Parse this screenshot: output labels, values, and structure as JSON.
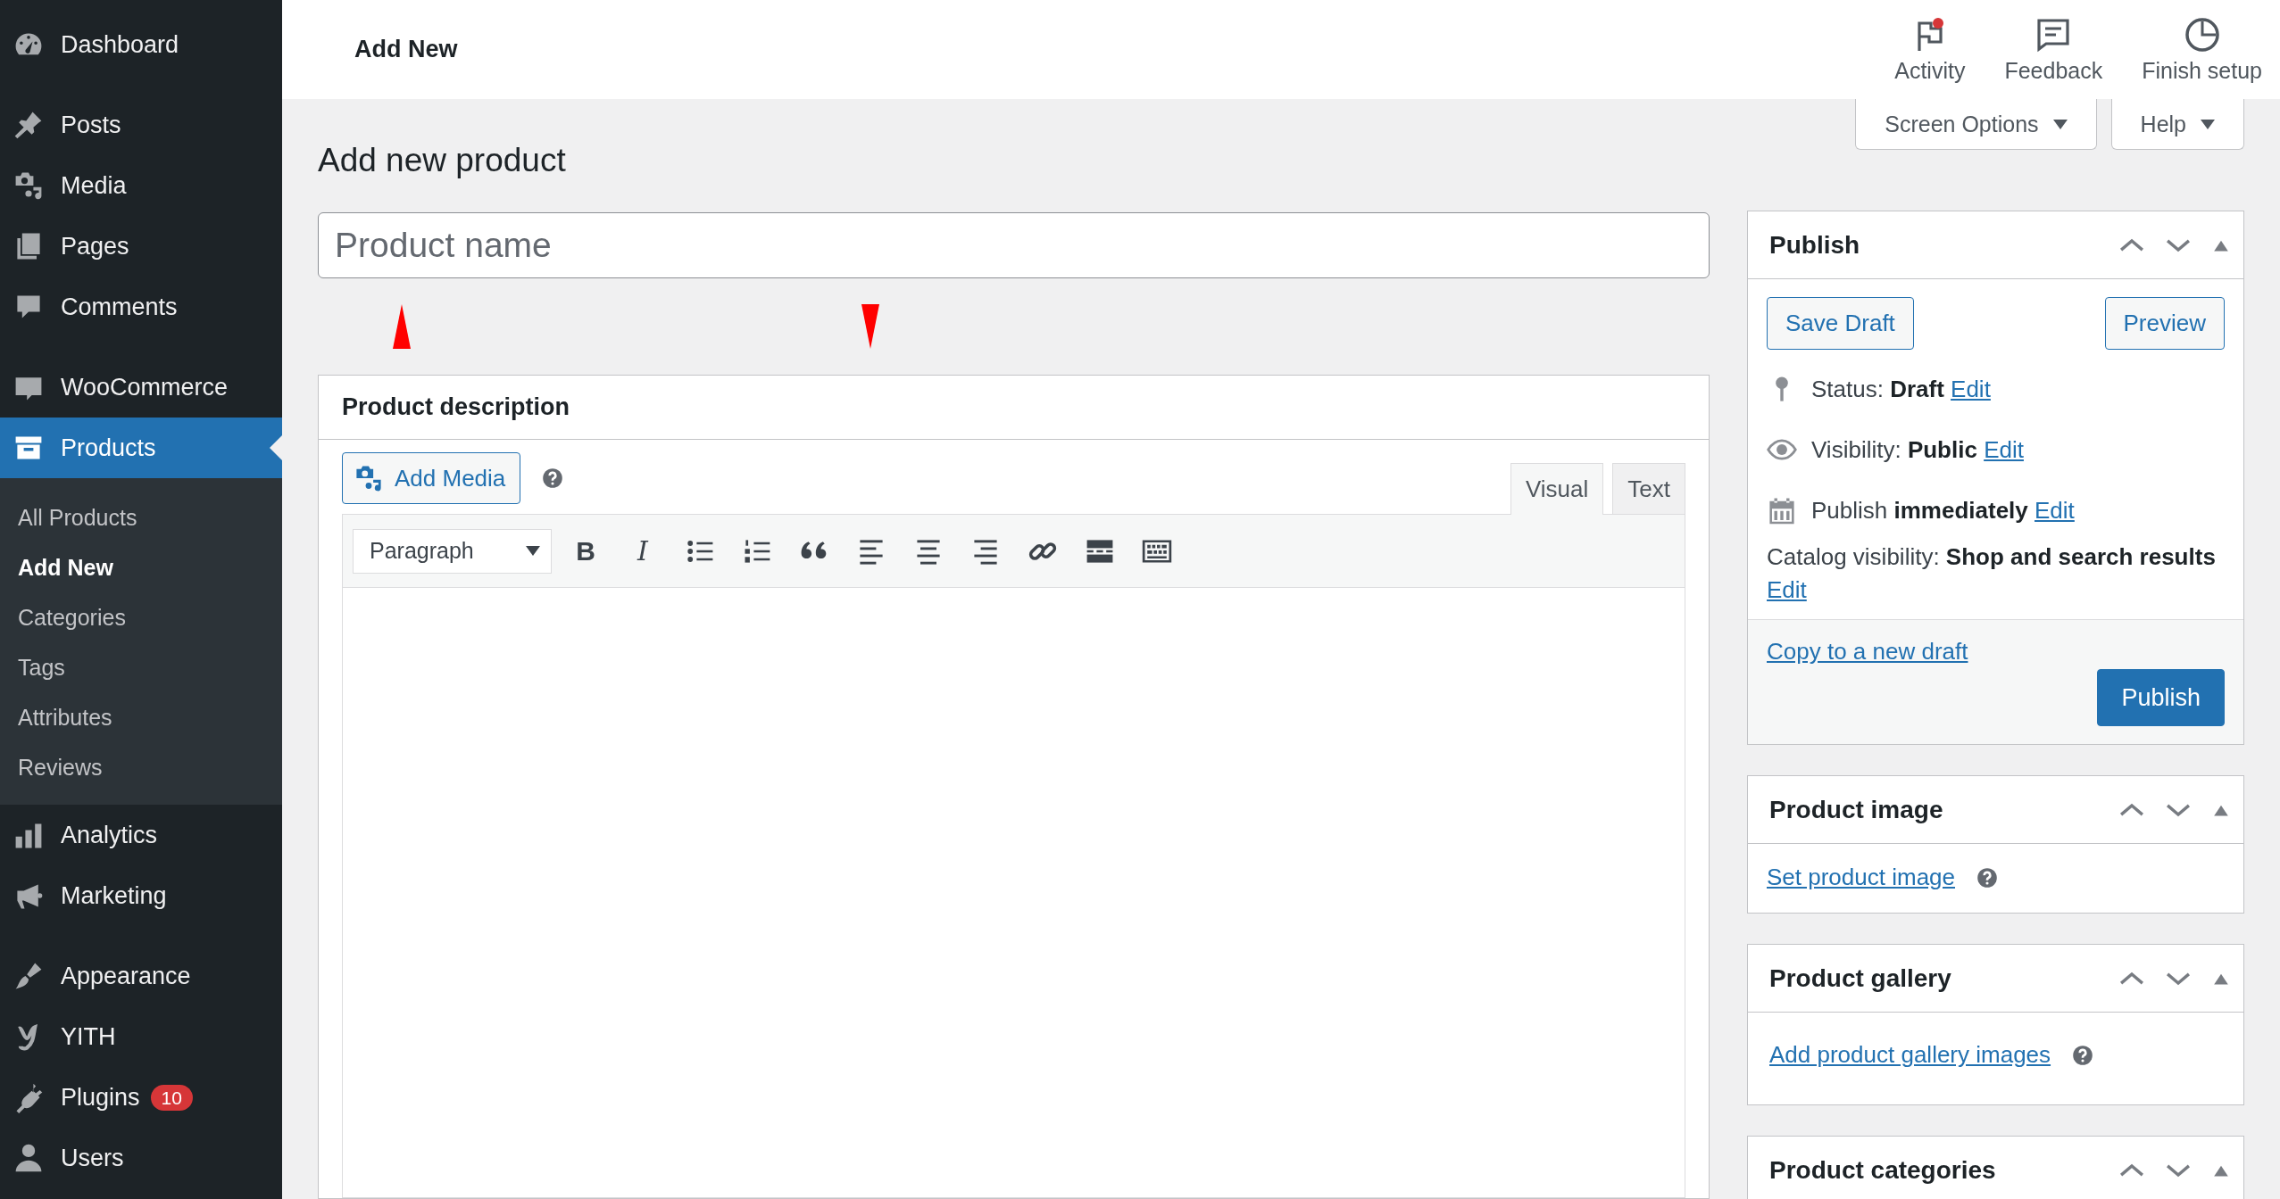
{
  "sidebar": {
    "groups": [
      [
        {
          "label": "Dashboard",
          "selected": false
        }
      ],
      [
        {
          "label": "Posts",
          "selected": false
        },
        {
          "label": "Media",
          "selected": false
        },
        {
          "label": "Pages",
          "selected": false
        },
        {
          "label": "Comments",
          "selected": false
        }
      ],
      [
        {
          "label": "WooCommerce",
          "selected": false
        },
        {
          "label": "Products",
          "selected": true,
          "children": [
            {
              "label": "All Products",
              "selected": false
            },
            {
              "label": "Add New",
              "selected": true
            },
            {
              "label": "Categories",
              "selected": false
            },
            {
              "label": "Tags",
              "selected": false
            },
            {
              "label": "Attributes",
              "selected": false
            },
            {
              "label": "Reviews",
              "selected": false
            }
          ]
        },
        {
          "label": "Analytics",
          "selected": false
        },
        {
          "label": "Marketing",
          "selected": false
        }
      ],
      [
        {
          "label": "Appearance",
          "selected": false
        },
        {
          "label": "YITH",
          "selected": false
        },
        {
          "label": "Plugins",
          "selected": false,
          "badge": "10"
        },
        {
          "label": "Users",
          "selected": false
        }
      ]
    ]
  },
  "topbar": {
    "title": "Add New",
    "actions": [
      {
        "label": "Activity",
        "unread": true
      },
      {
        "label": "Feedback",
        "unread": false
      },
      {
        "label": "Finish setup",
        "unread": false
      }
    ]
  },
  "screen_tabs": [
    {
      "label": "Screen Options"
    },
    {
      "label": "Help"
    }
  ],
  "heading": "Add new product",
  "title_field": {
    "placeholder": "Product name"
  },
  "markers": [
    {
      "kind": "up"
    },
    {
      "kind": "down"
    }
  ],
  "description": {
    "title": "Product description",
    "add_media": "Add Media",
    "tabs": [
      {
        "label": "Visual",
        "selected": true
      },
      {
        "label": "Text",
        "selected": false
      }
    ],
    "format_select": "Paragraph",
    "toolbar": [
      {
        "kind": "bold",
        "label": "B"
      },
      {
        "kind": "italic",
        "label": "I"
      },
      {
        "kind": "icon"
      },
      {
        "kind": "icon"
      },
      {
        "kind": "icon"
      },
      {
        "kind": "icon"
      },
      {
        "kind": "icon"
      },
      {
        "kind": "icon"
      },
      {
        "kind": "icon"
      },
      {
        "kind": "icon"
      },
      {
        "kind": "icon"
      }
    ]
  },
  "publish": {
    "title": "Publish",
    "buttons": [
      "Save Draft",
      "Preview"
    ],
    "rows": [
      {
        "text": "Status: **Draft**",
        "link": "Edit"
      },
      {
        "text": "Visibility: **Public**",
        "link": "Edit"
      },
      {
        "text": "Publish **immediately**",
        "link": "Edit"
      },
      {
        "text": "Catalog visibility: **Shop and search results**",
        "link": "Edit"
      }
    ],
    "copy_link": "Copy to a new draft",
    "publish_button": "Publish"
  },
  "side_boxes": [
    {
      "title": "Product image",
      "link": "Set product image"
    },
    {
      "title": "Product gallery",
      "link": "Add product gallery images"
    },
    {
      "title": "Product categories"
    }
  ]
}
